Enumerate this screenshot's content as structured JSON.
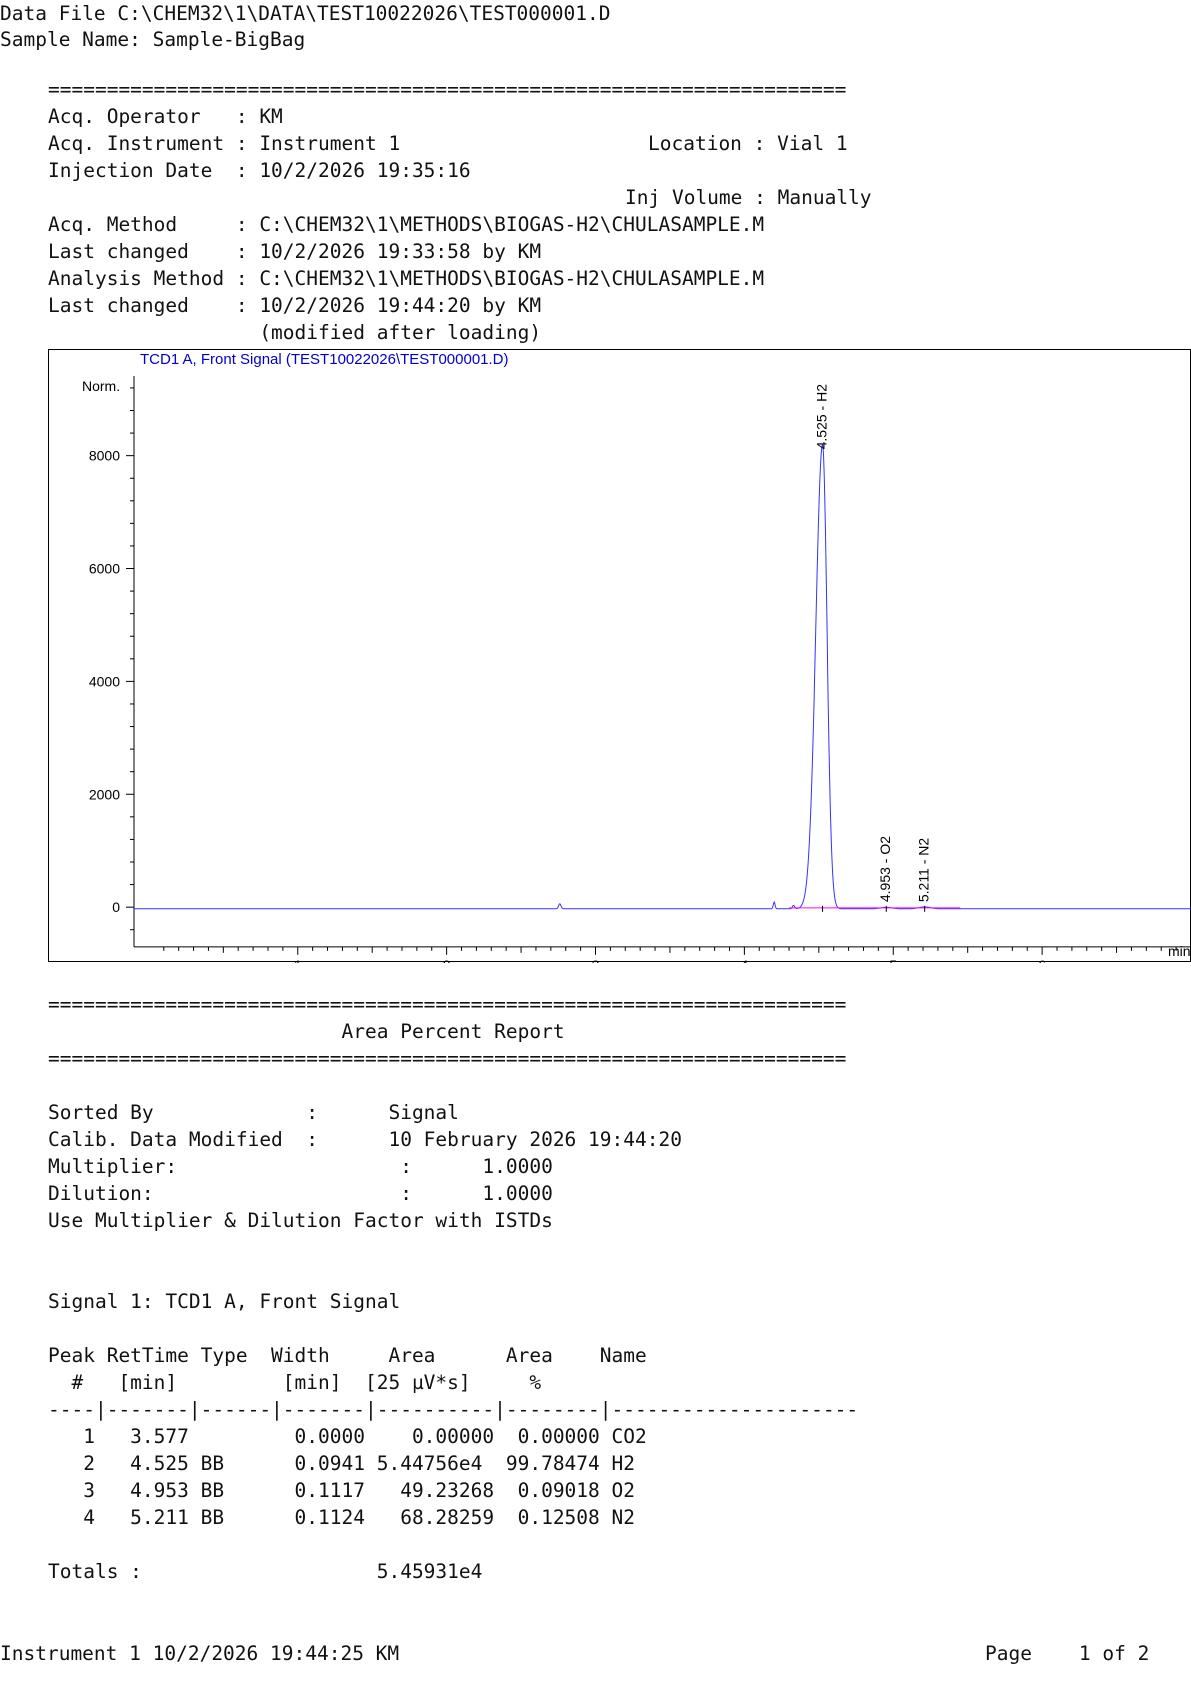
{
  "header": {
    "data_file": "Data File C:\\CHEM32\\1\\DATA\\TEST10022026\\TEST000001.D",
    "sample_name": "Sample Name: Sample-BigBag"
  },
  "separator": "====================================================================",
  "acq": {
    "operator": "Acq. Operator   : KM",
    "instrument": "Acq. Instrument : Instrument 1",
    "location": "Location : Vial 1",
    "injection_date": "Injection Date  : 10/2/2026 19:35:16",
    "inj_volume": "Inj Volume : Manually",
    "acq_method": "Acq. Method     : C:\\CHEM32\\1\\METHODS\\BIOGAS-H2\\CHULASAMPLE.M",
    "last_changed_1": "Last changed    : 10/2/2026 19:33:58 by KM",
    "analysis_method": "Analysis Method : C:\\CHEM32\\1\\METHODS\\BIOGAS-H2\\CHULASAMPLE.M",
    "last_changed_2": "Last changed    : 10/2/2026 19:44:20 by KM",
    "modified_note": "                  (modified after loading)"
  },
  "chart_data": {
    "type": "line",
    "title": "TCD1 A, Front Signal (TEST10022026\\TEST000001.D)",
    "ylabel": "Norm.",
    "xlabel": "min",
    "xlim": [
      -0.1,
      7.0
    ],
    "ylim": [
      -600,
      9500
    ],
    "xticks": [
      1,
      2,
      3,
      4,
      5,
      6
    ],
    "yticks": [
      0,
      2000,
      4000,
      6000,
      8000
    ],
    "peaks": [
      {
        "label": "4.525 - H2",
        "rt": 4.525,
        "height": 8200
      },
      {
        "label": "4.953 - O2",
        "rt": 4.953,
        "height": 6
      },
      {
        "label": "5.211 - N2",
        "rt": 5.211,
        "height": 8
      }
    ],
    "baseline": -30,
    "colors": {
      "trace": "#3333ff",
      "baseline": "#ff00ff",
      "title": "#0000cc",
      "axis": "#000000"
    }
  },
  "report": {
    "title": "                         Area Percent Report",
    "sorted_by": "Sorted By             :      Signal",
    "calib": "Calib. Data Modified  :      10 February 2026 19:44:20",
    "multiplier": "Multiplier:                   :      1.0000",
    "dilution": "Dilution:                     :      1.0000",
    "use_multiplier": "Use Multiplier & Dilution Factor with ISTDs",
    "signal": "Signal 1: TCD1 A, Front Signal",
    "col_header_1": "Peak RetTime Type  Width     Area      Area    Name",
    "col_header_2": "  #   [min]         [min]  [25 µV*s]     %",
    "col_sep": "----|-------|------|-------|----------|--------|---------------------",
    "rows": [
      "   1   3.577         0.0000    0.00000  0.00000 CO2",
      "   2   4.525 BB      0.0941 5.44756e4  99.78474 H2",
      "   3   4.953 BB      0.1117   49.23268  0.09018 O2",
      "   4   5.211 BB      0.1124   68.28259  0.12508 N2"
    ],
    "totals": "Totals :                    5.45931e4"
  },
  "footer": {
    "left": "Instrument 1 10/2/2026 19:44:25 KM",
    "right": "Page    1 of 2"
  }
}
